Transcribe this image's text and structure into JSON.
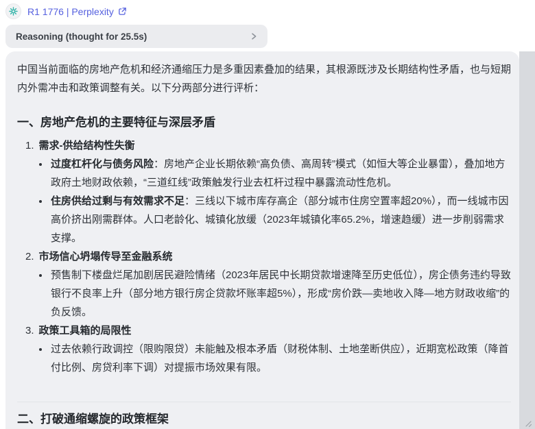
{
  "header": {
    "model_label": "R1 1776 | Perplexity",
    "reasoning_label": "Reasoning (thought for 25.5s)"
  },
  "icons": {
    "model_icon": "starburst-icon",
    "external_link_icon": "external-link-icon",
    "chevron_icon": "chevron-right-icon",
    "resize_grip": "resize-grip-icon"
  },
  "colors": {
    "link_blue": "#5560df",
    "icon_teal": "#35b5aa",
    "card_bg": "#eff0f3",
    "pill_bg": "#ebecef",
    "scroll_strip": "#d8dade",
    "body_text": "#2e3238"
  },
  "content": {
    "intro": "中国当前面临的房地产危机和经济通缩压力是多重因素叠加的结果，其根源既涉及长期结构性矛盾，也与短期内外需冲击和政策调整有关。以下分两部分进行评析：",
    "section1": {
      "title": "一、房地产危机的主要特征与深层矛盾",
      "items": [
        {
          "num": "1.",
          "title": "需求-供给结构性失衡",
          "bullets": [
            {
              "lead": "过度杠杆化与债务风险",
              "text": "：房地产企业长期依赖“高负债、高周转”模式（如恒大等企业暴雷），叠加地方政府土地财政依赖，“三道红线”政策触发行业去杠杆过程中暴露流动性危机。"
            },
            {
              "lead": "住房供给过剩与有效需求不足",
              "text": "：三线以下城市库存高企（部分城市住房空置率超20%），而一线城市因高价挤出刚需群体。人口老龄化、城镇化放缓（2023年城镇化率65.2%，增速趋缓）进一步削弱需求支撑。"
            }
          ]
        },
        {
          "num": "2.",
          "title": "市场信心坍塌传导至金融系统",
          "bullets": [
            {
              "lead": "",
              "text": "预售制下楼盘烂尾加剧居民避险情绪（2023年居民中长期贷款增速降至历史低位），房企债务违约导致银行不良率上升（部分地方银行房企贷款坏账率超5%），形成“房价跌—卖地收入降—地方财政收缩”的负反馈。"
            }
          ]
        },
        {
          "num": "3.",
          "title": "政策工具箱的局限性",
          "bullets": [
            {
              "lead": "",
              "text": "过去依赖行政调控（限购限贷）未能触及根本矛盾（财税体制、土地垄断供应），近期宽松政策（降首付比例、房贷利率下调）对提振市场效果有限。"
            }
          ]
        }
      ]
    },
    "section2": {
      "title": "二、打破通缩螺旋的政策框架"
    }
  }
}
